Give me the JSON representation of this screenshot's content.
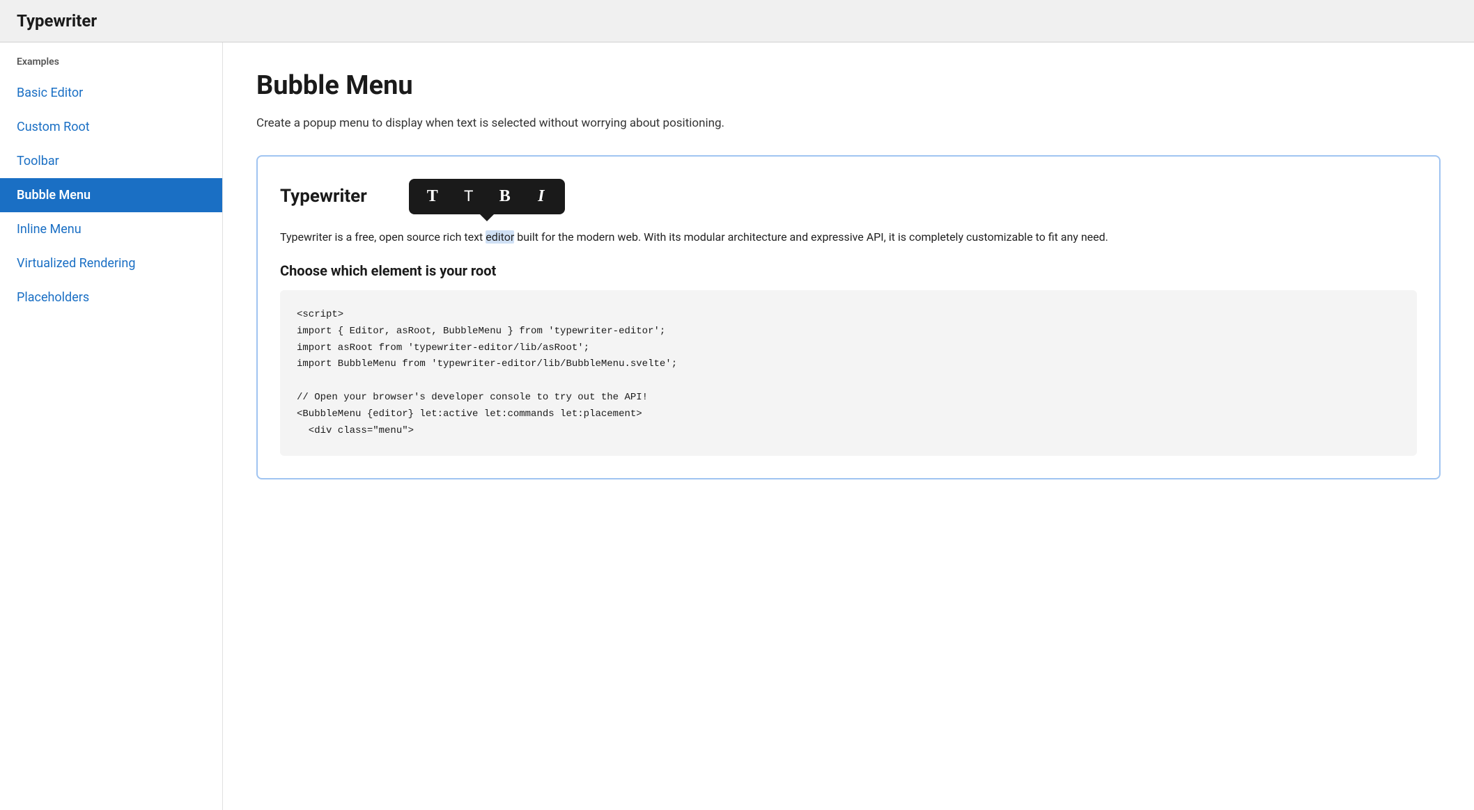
{
  "header": {
    "title": "Typewriter"
  },
  "sidebar": {
    "section_label": "Examples",
    "items": [
      {
        "id": "basic-editor",
        "label": "Basic Editor",
        "active": false
      },
      {
        "id": "custom-root",
        "label": "Custom Root",
        "active": false
      },
      {
        "id": "toolbar",
        "label": "Toolbar",
        "active": false
      },
      {
        "id": "bubble-menu",
        "label": "Bubble Menu",
        "active": true
      },
      {
        "id": "inline-menu",
        "label": "Inline Menu",
        "active": false
      },
      {
        "id": "virtualized-rendering",
        "label": "Virtualized Rendering",
        "active": false
      },
      {
        "id": "placeholders",
        "label": "Placeholders",
        "active": false
      }
    ]
  },
  "content": {
    "page_title": "Bubble Menu",
    "description": "Create a popup menu to display when text is selected without worrying about positioning.",
    "editor": {
      "title": "Typewriter",
      "bubble_buttons": [
        {
          "id": "btn-serif-t",
          "label": "T",
          "style": "serif-t"
        },
        {
          "id": "btn-sans-t",
          "label": "T",
          "style": "sans-t"
        },
        {
          "id": "btn-bold",
          "label": "B",
          "style": "bold-b"
        },
        {
          "id": "btn-italic",
          "label": "I",
          "style": "italic-i"
        }
      ],
      "body_text_before": "Typewriter is a free, open source rich text ",
      "body_text_highlight": "editor",
      "body_text_after": " built for the modern web. With its modular architecture and expressive API, it is completely customizable to fit any need.",
      "section_title": "Choose which element is your root",
      "code_lines": [
        "<script>",
        "import { Editor, asRoot, BubbleMenu } from 'typewriter-editor';",
        "import asRoot from 'typewriter-editor/lib/asRoot';",
        "import BubbleMenu from 'typewriter-editor/lib/BubbleMenu.svelte';",
        "",
        "// Open your browser's developer console to try out the API!",
        "<BubbleMenu {editor} let:active let:commands let:placement>",
        "  <div class=\"menu\">"
      ]
    }
  }
}
